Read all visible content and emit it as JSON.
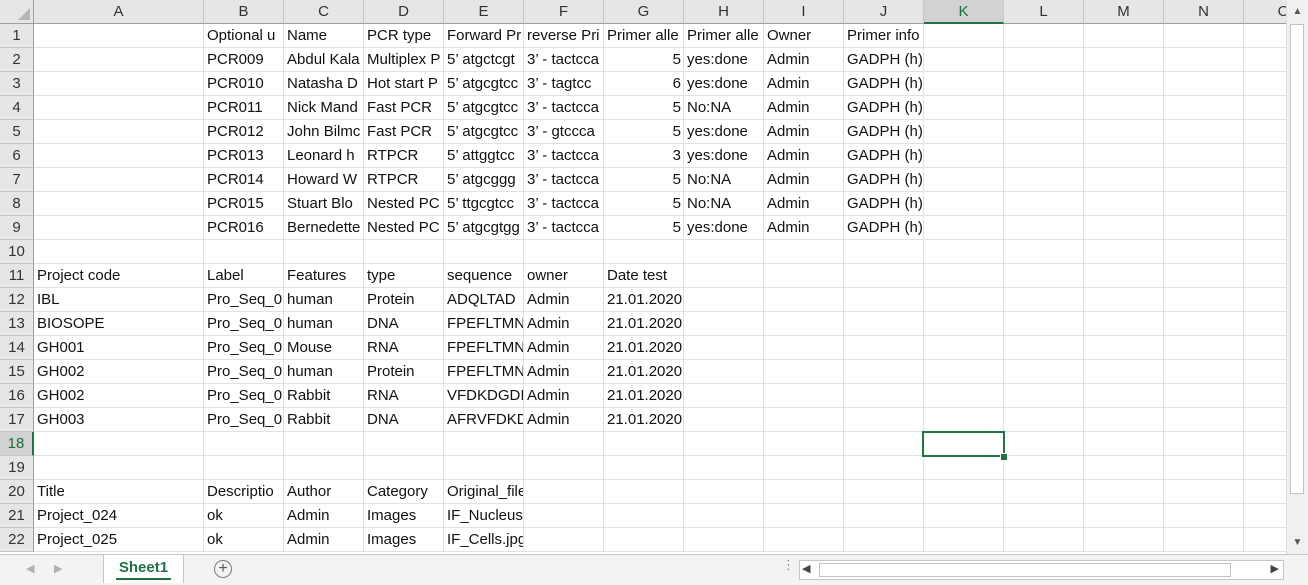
{
  "columns": [
    "A",
    "B",
    "C",
    "D",
    "E",
    "F",
    "G",
    "H",
    "I",
    "J",
    "K",
    "L",
    "M",
    "N",
    "O"
  ],
  "selected_column": "K",
  "selected_row": "18",
  "rows": [
    {
      "n": "1",
      "cells": {
        "B": "Optional u",
        "C": "Name",
        "D": "PCR type",
        "E": "Forward Pr",
        "F": "reverse Pri",
        "G": "Primer alle",
        "H": "Primer alle",
        "I": "Owner",
        "J": "Primer info"
      }
    },
    {
      "n": "2",
      "cells": {
        "B": "PCR009",
        "C": "Abdul Kala",
        "D": "Multiplex P",
        "E": "5’ atgctcgt",
        "F": "3’ - tactcca",
        "G": "5",
        "H": "yes:done",
        "I": "Admin",
        "J": "GADPH (h)"
      }
    },
    {
      "n": "3",
      "cells": {
        "B": "PCR010",
        "C": "Natasha D",
        "D": "Hot start P",
        "E": "5’ atgcgtcc",
        "F": "3’ - tagtcc",
        "G": "6",
        "H": "yes:done",
        "I": "Admin",
        "J": "GADPH (h)"
      }
    },
    {
      "n": "4",
      "cells": {
        "B": "PCR011",
        "C": "Nick Mand",
        "D": "Fast PCR",
        "E": "5’ atgcgtcc",
        "F": "3’ - tactcca",
        "G": "5",
        "H": "No:NA",
        "I": "Admin",
        "J": "GADPH (h)"
      }
    },
    {
      "n": "5",
      "cells": {
        "B": "PCR012",
        "C": "John Bilmc",
        "D": "Fast PCR",
        "E": "5’ atgcgtcc",
        "F": "3’ - gtccca",
        "G": "5",
        "H": "yes:done",
        "I": "Admin",
        "J": "GADPH (h)"
      }
    },
    {
      "n": "6",
      "cells": {
        "B": "PCR013",
        "C": "Leonard h",
        "D": "RTPCR",
        "E": "5’ attggtcc",
        "F": "3’ - tactcca",
        "G": "3",
        "H": "yes:done",
        "I": "Admin",
        "J": "GADPH (h)"
      }
    },
    {
      "n": "7",
      "cells": {
        "B": "PCR014",
        "C": "Howard W",
        "D": "RTPCR",
        "E": "5’ atgcggg",
        "F": "3’ - tactcca",
        "G": "5",
        "H": "No:NA",
        "I": "Admin",
        "J": "GADPH (h)"
      }
    },
    {
      "n": "8",
      "cells": {
        "B": "PCR015",
        "C": "Stuart Blo",
        "D": "Nested PC",
        "E": "5’ ttgcgtcc",
        "F": "3’ - tactcca",
        "G": "5",
        "H": "No:NA",
        "I": "Admin",
        "J": "GADPH (h)"
      }
    },
    {
      "n": "9",
      "cells": {
        "B": "PCR016",
        "C": "Bernedette",
        "D": "Nested PC",
        "E": "5’ atgcgtgg",
        "F": "3’ - tactcca",
        "G": "5",
        "H": "yes:done",
        "I": "Admin",
        "J": "GADPH (h)"
      }
    },
    {
      "n": "10",
      "cells": {}
    },
    {
      "n": "11",
      "cells": {
        "A": "Project code",
        "B": "Label",
        "C": "Features",
        "D": "type",
        "E": "sequence",
        "F": "owner",
        "G": "Date test"
      }
    },
    {
      "n": "12",
      "cells": {
        "A": "IBL",
        "B": "Pro_Seq_0",
        "C": "human",
        "D": "Protein",
        "E": "ADQLTAD",
        "F": "Admin",
        "G": "21.01.2020"
      }
    },
    {
      "n": "13",
      "cells": {
        "A": "BIOSOPE",
        "B": "Pro_Seq_0",
        "C": "human",
        "D": "DNA",
        "E": "FPEFLTMN",
        "F": "Admin",
        "G": "21.01.2020"
      }
    },
    {
      "n": "14",
      "cells": {
        "A": "GH001",
        "B": "Pro_Seq_0",
        "C": "Mouse",
        "D": "RNA",
        "E": "FPEFLTMN",
        "F": "Admin",
        "G": "21.01.2020"
      }
    },
    {
      "n": "15",
      "cells": {
        "A": "GH002",
        "B": "Pro_Seq_0",
        "C": "human",
        "D": "Protein",
        "E": "FPEFLTMN",
        "F": "Admin",
        "G": "21.01.2020"
      }
    },
    {
      "n": "16",
      "cells": {
        "A": "GH002",
        "B": "Pro_Seq_0",
        "C": "Rabbit",
        "D": "RNA",
        "E": "VFDKDGDI",
        "F": "Admin",
        "G": "21.01.2020"
      }
    },
    {
      "n": "17",
      "cells": {
        "A": "GH003",
        "B": "Pro_Seq_0",
        "C": "Rabbit",
        "D": "DNA",
        "E": "AFRVFDKD",
        "F": "Admin",
        "G": "21.01.2020"
      }
    },
    {
      "n": "18",
      "cells": {}
    },
    {
      "n": "19",
      "cells": {}
    },
    {
      "n": "20",
      "cells": {
        "A": "Title",
        "B": "Descriptio",
        "C": "Author",
        "D": "Category",
        "E": "Original_file_name"
      }
    },
    {
      "n": "21",
      "cells": {
        "A": "Project_024",
        "B": "ok",
        "C": "Admin",
        "D": "Images",
        "E": "IF_Nucleus.jfif"
      }
    },
    {
      "n": "22",
      "cells": {
        "A": "Project_025",
        "B": "ok",
        "C": "Admin",
        "D": "Images",
        "E": "IF_Cells.jpg"
      }
    }
  ],
  "numeric_columns": [
    "G"
  ],
  "numeric_rows": [
    "2",
    "3",
    "4",
    "5",
    "6",
    "7",
    "8",
    "9"
  ],
  "sheet_tab": "Sheet1",
  "add_sheet_symbol": "+",
  "icons": {
    "nav_prev": "◀",
    "nav_next": "▶",
    "scroll_up": "▲",
    "scroll_down": "▼",
    "scroll_left": "◀",
    "scroll_right": "▶",
    "splitter": "⋮"
  }
}
